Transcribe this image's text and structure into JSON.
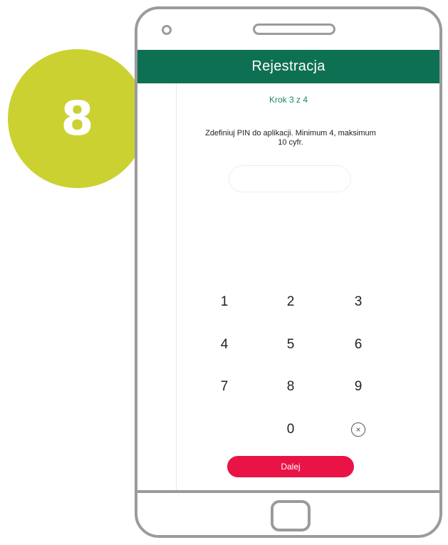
{
  "step_badge": {
    "number": "8"
  },
  "header": {
    "title": "Rejestracja"
  },
  "step_indicator": "Krok 3 z 4",
  "instruction": {
    "line1": "Zdefiniuj PIN do aplikacji. Minimum 4, maksimum",
    "line2": "10 cyfr."
  },
  "pin_input": {
    "value": "",
    "placeholder": ""
  },
  "keypad": {
    "keys": [
      "1",
      "2",
      "3",
      "4",
      "5",
      "6",
      "7",
      "8",
      "9",
      "0"
    ],
    "delete_icon": "clear-circle-icon",
    "delete_glyph": "×"
  },
  "next_button": {
    "label": "Dalej"
  },
  "colors": {
    "header": "#0e7052",
    "step_text": "#1a8a5e",
    "primary_button": "#ea1346",
    "badge": "#ccd132",
    "device_frame": "#9b9b9b"
  }
}
